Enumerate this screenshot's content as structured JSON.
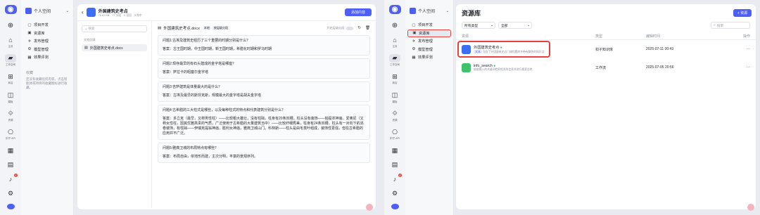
{
  "left": {
    "rail": {
      "labels": [
        "主页",
        "工作空间",
        "商店",
        "模板",
        "资源",
        "扣子·API"
      ],
      "badge": "2"
    },
    "space": "个人空间",
    "menu": [
      {
        "icon": "project-icon",
        "label": "项目开发"
      },
      {
        "icon": "library-icon",
        "label": "资源库"
      },
      {
        "icon": "publish-icon",
        "label": "发布管理"
      },
      {
        "icon": "model-icon",
        "label": "模型管理"
      },
      {
        "icon": "eval-icon",
        "label": "效果评测"
      }
    ],
    "favorites_title": "收藏",
    "favorites_empty": "还没有收藏任何内容，点击智能体或项目的收藏图标进行收藏。"
  },
  "editor": {
    "title": "外国建筑史考点",
    "subtitle_tags": [
      "76.61 KB",
      "77 分段",
      "0 召回",
      "5 命中"
    ],
    "add_button": "添加内容",
    "search_placeholder": "搜索",
    "section_label": "文档列表",
    "file_name": "外国建筑史考点.docx",
    "doc_header": "外国建筑史考点.docx",
    "doc_tags": [
      "本地",
      "按层级分段"
    ],
    "doc_toggle_label": "开启层级分段",
    "qa": [
      {
        "q": "问题1:古埃及建筑史经历了三个重要的时期分别是什么？",
        "a": "答案：古王国时期，中王国时期，新王国时期，希腊化时期和罗马时期"
      },
      {
        "q": "问题2:现存最早的有石头建成的金字塔是哪座？",
        "a": "答案：萨拉卡的昭塞尔金字塔"
      },
      {
        "q": "问题3:吉萨建筑是体量最大的是什么？",
        "a": "答案：古埃及最早的斯芬克斯，规模最大的金字塔是胡夫金字塔"
      },
      {
        "q": "问题4:古希腊的三大柱式是哪些，以及每种柱式的特点和代表建筑分别是什么？",
        "a": "答案：多立克（最早，又称男性柱）——比较粗大雄壮，没有柱础，柱身有20条凹槽，柱头没有装饰——帕提农神庙。爱奥尼（又称女性柱，因其优雅高贵的气质，广泛使用于古希腊的大量建筑当中）——比较纤细秀美，柱身有24条凹槽，柱头有一对向下的涡卷装饰，有柱础——伊瑞克提翁神庙，胜利女神庙，雅典卫城山门。科林斯——柱头是由毛茛叶组成，装饰性更强，但在古希腊的应用并不广泛。"
      },
      {
        "q": "问题5:雅典卫城的布局特点有哪些？",
        "a": "答案：布局自由，依地形而建，主次分明，丰富的景观序列。"
      }
    ]
  },
  "right": {
    "space": "个人空间",
    "menu": [
      {
        "icon": "project-icon",
        "label": "项目开发"
      },
      {
        "icon": "library-icon",
        "label": "资源库"
      },
      {
        "icon": "publish-icon",
        "label": "发布管理"
      },
      {
        "icon": "model-icon",
        "label": "模型管理"
      },
      {
        "icon": "eval-icon",
        "label": "效果评测"
      }
    ],
    "page_title": "资源库",
    "new_button": "+ 资源",
    "filter_type": "所有类型",
    "filter_all": "全部",
    "search_placeholder": "搜索",
    "columns": [
      "资源",
      "类型",
      "编辑时间",
      "操作"
    ],
    "rows": [
      {
        "name": "外国建筑史考点",
        "tag": "文本",
        "desc": "包含了外国建筑史近门课程题库并带有解答的知识点",
        "type": "扣子知识库",
        "time": "2025-07-11 00:43",
        "color": "#3b6ef5",
        "highlight": true
      },
      {
        "name": "info_search",
        "tag": "",
        "desc": "根据输入的关键词检索相关的信息并进行搜索总结",
        "type": "工作流",
        "time": "2025-07-05 20:56",
        "color": "#3fc26b",
        "highlight": false
      }
    ]
  },
  "colors": {
    "accent": "#4e5ff5",
    "highlight": "#e8413c"
  }
}
